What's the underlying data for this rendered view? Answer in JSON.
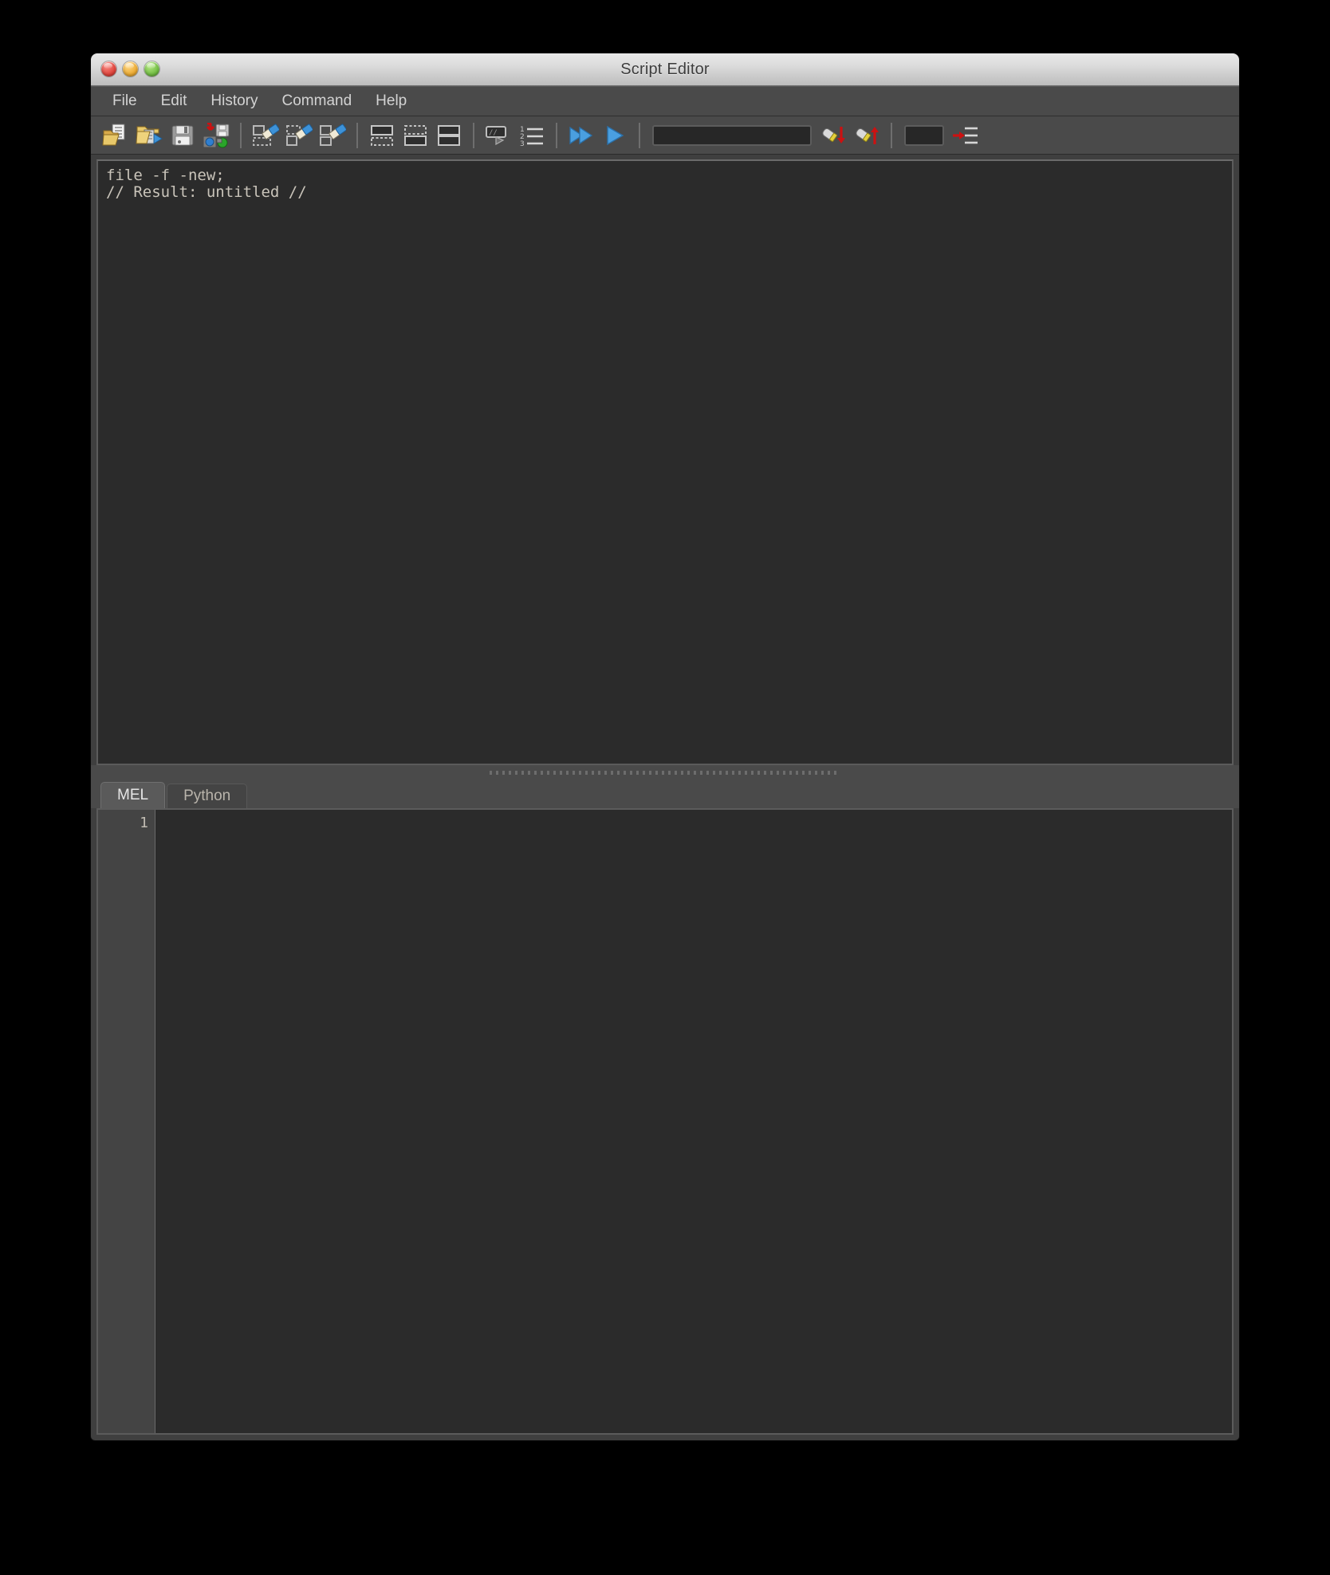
{
  "window": {
    "title": "Script Editor",
    "controls": [
      {
        "name": "close",
        "color": "#e0453c"
      },
      {
        "name": "minimize",
        "color": "#ecab33"
      },
      {
        "name": "zoom",
        "color": "#74bf45"
      }
    ]
  },
  "menubar": {
    "items": [
      {
        "label": "File"
      },
      {
        "label": "Edit"
      },
      {
        "label": "History"
      },
      {
        "label": "Command"
      },
      {
        "label": "Help"
      }
    ]
  },
  "toolbar": {
    "buttons": [
      {
        "icon": "open-script-icon",
        "tooltip": "Open Script"
      },
      {
        "icon": "open-and-execute-script-icon",
        "tooltip": "Open and Execute Script"
      },
      {
        "icon": "save-script-icon",
        "tooltip": "Save Script"
      },
      {
        "icon": "save-script-to-shelf-icon",
        "tooltip": "Save Script to Shelf"
      },
      {
        "icon": "clear-history-icon",
        "tooltip": "Clear History"
      },
      {
        "icon": "clear-input-icon",
        "tooltip": "Clear Input"
      },
      {
        "icon": "clear-all-icon",
        "tooltip": "Clear All"
      },
      {
        "icon": "show-history-pane-icon",
        "tooltip": "Show History Pane Only"
      },
      {
        "icon": "show-input-pane-icon",
        "tooltip": "Show Input Pane Only"
      },
      {
        "icon": "show-both-panes-icon",
        "tooltip": "Show Both Panes"
      },
      {
        "icon": "command-echo-icon",
        "tooltip": "Echo All Commands"
      },
      {
        "icon": "line-numbers-icon",
        "tooltip": "Show Line Numbers"
      },
      {
        "icon": "execute-all-icon",
        "tooltip": "Execute All"
      },
      {
        "icon": "execute-selection-icon",
        "tooltip": "Execute Selection"
      },
      {
        "icon": "search-down-icon",
        "tooltip": "Search Down"
      },
      {
        "icon": "search-up-icon",
        "tooltip": "Search Up"
      },
      {
        "icon": "indent-icon",
        "tooltip": "Tab Width"
      }
    ],
    "search_field": {
      "value": "",
      "placeholder": ""
    },
    "tabwidth_field": {
      "value": "",
      "placeholder": ""
    },
    "accent_colors": {
      "execute_blue": "#4a9fe0",
      "arrow_red": "#cc1111",
      "folder_yellow": "#e8c86a",
      "eraser_blue": "#2f7fd0"
    }
  },
  "history_pane": {
    "name": "history-output",
    "lines": [
      "file -f -new;",
      "// Result: untitled //"
    ],
    "text": "file -f -new;\n// Result: untitled //"
  },
  "splitter": {
    "name": "pane-splitter"
  },
  "tabs": [
    {
      "label": "MEL",
      "active": true
    },
    {
      "label": "Python",
      "active": false
    }
  ],
  "editor_pane": {
    "name": "script-input",
    "gutter_lines": "1",
    "text": ""
  }
}
